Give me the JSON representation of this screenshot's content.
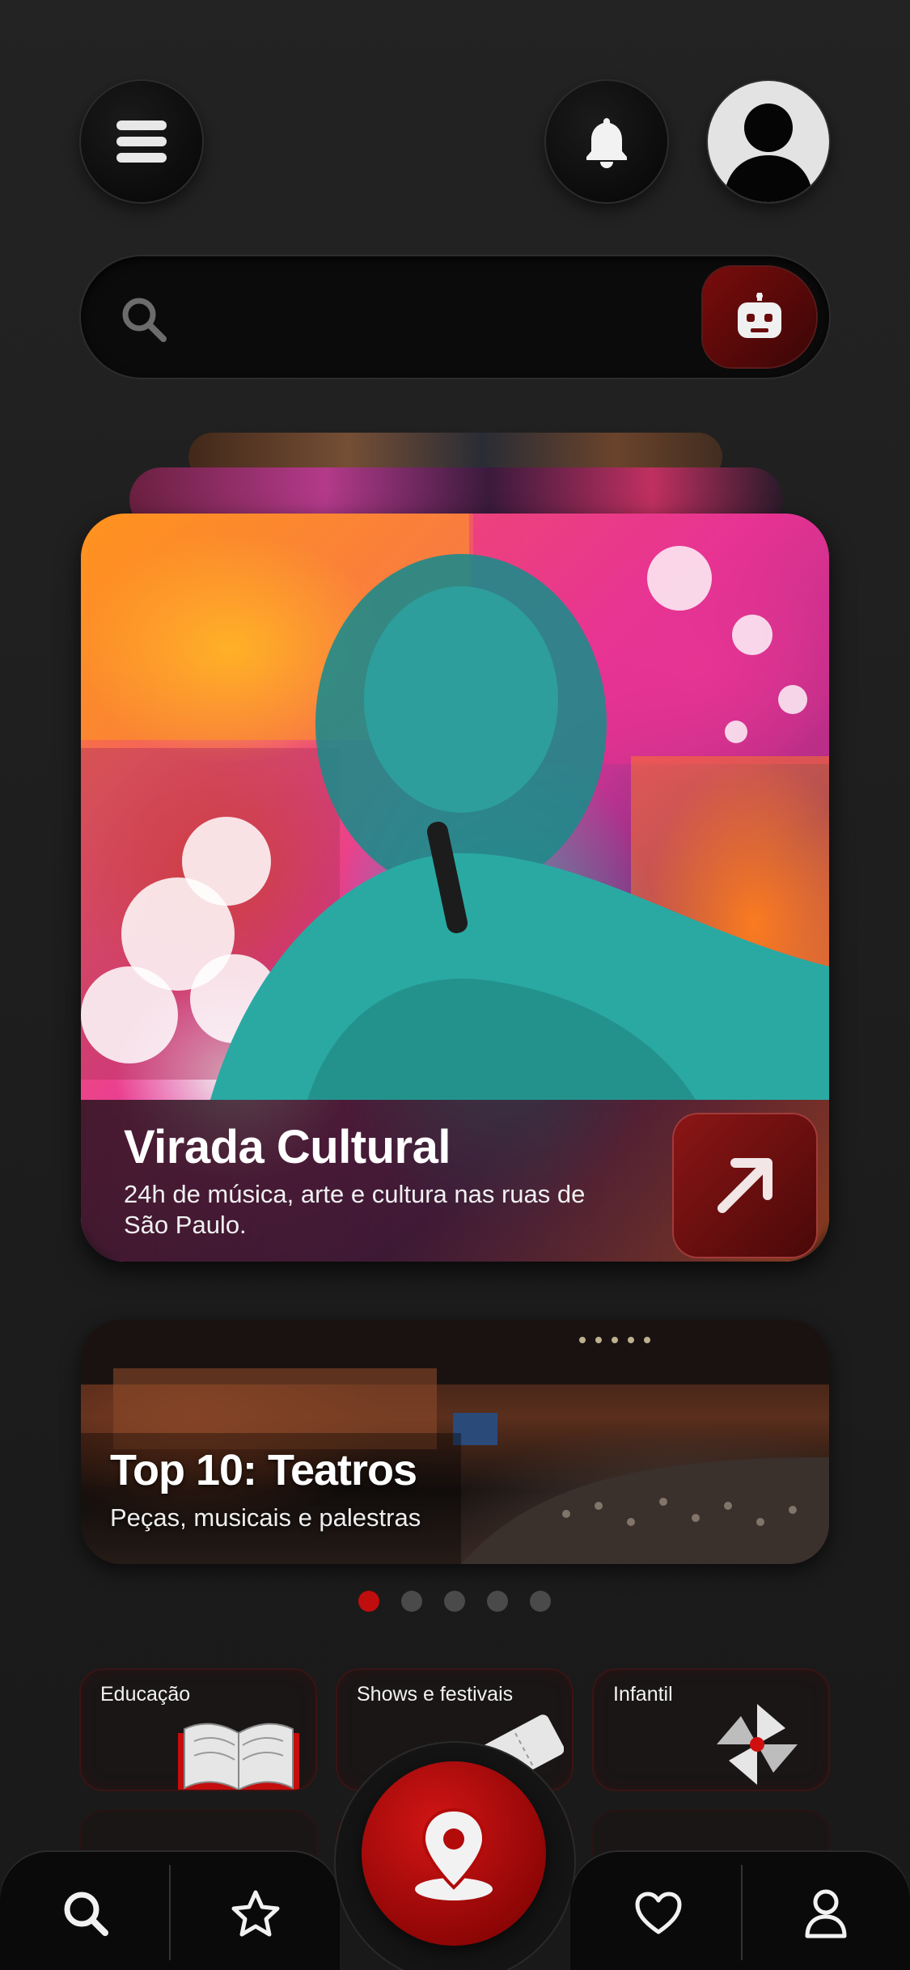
{
  "header": {
    "menu_icon": "hamburger-menu-icon",
    "notification_icon": "bell-icon",
    "avatar_icon": "user-avatar-icon"
  },
  "search": {
    "placeholder": "",
    "icon": "search-icon",
    "assistant_icon": "robot-icon"
  },
  "featured": {
    "title": "Virada Cultural",
    "subtitle": "24h de música, arte e cultura nas ruas de São Paulo.",
    "action_icon": "arrow-up-right-icon"
  },
  "secondary_card": {
    "title": "Top 10: Teatros",
    "subtitle": "Peças, musicais e palestras"
  },
  "carousel": {
    "total": 5,
    "active": 1
  },
  "categories": [
    {
      "label": "Educação",
      "icon": "book-icon"
    },
    {
      "label": "Shows e festivais",
      "icon": "ticket-icon"
    },
    {
      "label": "Infantil",
      "icon": "pinwheel-icon"
    }
  ],
  "bottom_nav": {
    "items": [
      {
        "icon": "search-icon"
      },
      {
        "icon": "star-icon"
      },
      {
        "icon": "map-pin-icon"
      },
      {
        "icon": "heart-icon"
      },
      {
        "icon": "user-icon"
      }
    ]
  },
  "colors": {
    "accent": "#c00d0d",
    "background": "#1f1f1f"
  }
}
